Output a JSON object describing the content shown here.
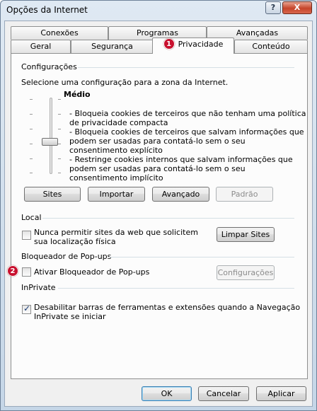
{
  "window": {
    "title": "Opções da Internet",
    "help_label": "?",
    "close_label": "X"
  },
  "tabs": {
    "row1": [
      "Conexões",
      "Programas",
      "Avançadas"
    ],
    "row2": [
      "Geral",
      "Segurança",
      "Privacidade",
      "Conteúdo"
    ],
    "active_badge": "1"
  },
  "settings": {
    "title": "Configurações",
    "instruction": "Selecione uma configuração para a zona da Internet.",
    "level": "Médio",
    "descriptions": [
      "- Bloqueia cookies de terceiros que não tenham uma política",
      "de privacidade compacta",
      "- Bloqueia cookies de terceiros que salvam informações que",
      "podem ser usadas para contatá-lo sem o seu",
      "consentimento explícito",
      "- Restringe cookies internos que salvam informações que",
      "podem ser usadas para contatá-lo sem o seu",
      "consentimento implícito"
    ],
    "buttons": {
      "sites": "Sites",
      "import": "Importar",
      "advanced": "Avançado",
      "default": "Padrão"
    },
    "slider_level": "3 of 6"
  },
  "location": {
    "title": "Local",
    "checkbox_line1": "Nunca permitir sites da web que solicitem",
    "checkbox_line2": "sua localização física",
    "clear_button": "Limpar Sites"
  },
  "popup": {
    "title": "Bloqueador de Pop-ups",
    "badge": "2",
    "checkbox_label": "Ativar Bloqueador de Pop-ups",
    "settings_button": "Configurações"
  },
  "inprivate": {
    "title": "InPrivate",
    "checkbox_line1": "Desabilitar barras de ferramentas e extensões quando a Navegação",
    "checkbox_line2": "InPrivate se iniciar"
  },
  "footer": {
    "ok": "OK",
    "cancel": "Cancelar",
    "apply": "Aplicar"
  }
}
